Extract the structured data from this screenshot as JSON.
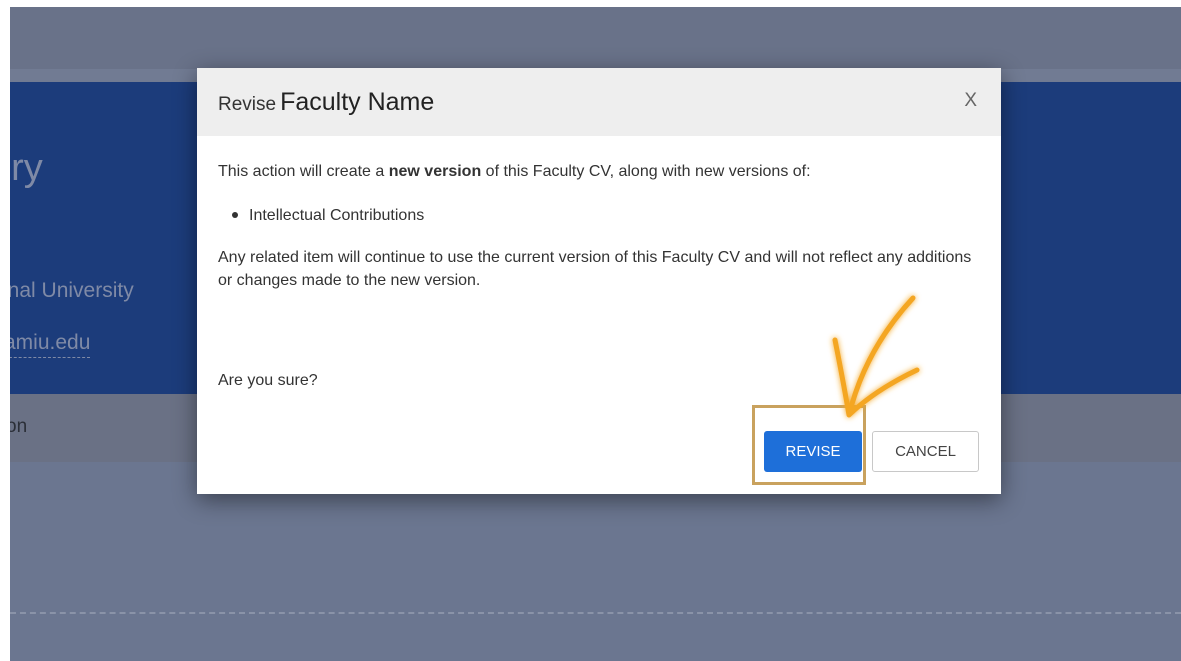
{
  "background": {
    "name_fragment": "dry",
    "university_fragment": "onal University",
    "email_fragment": "amiu.edu",
    "tab_fragment": "on"
  },
  "modal": {
    "title_prefix": "Revise",
    "title_name": "Faculty Name",
    "close_label": "X",
    "intro_before": "This action will create a ",
    "intro_bold": "new version",
    "intro_after": " of this Faculty CV, along with new versions of:",
    "list_items": [
      "Intellectual Contributions"
    ],
    "warning": "Any related item will continue to use the current version of this Faculty CV and will not reflect any additions or changes made to the new version.",
    "confirm_question": "Are you sure?",
    "revise_button": "REVISE",
    "cancel_button": "CANCEL"
  },
  "colors": {
    "primary_button": "#1e6fd9",
    "annotation": "#c9a25e",
    "overlay": "#6b7690",
    "hero": "#1c3c7b"
  },
  "annotation": {
    "highlight_icon": "checkmark-icon"
  }
}
